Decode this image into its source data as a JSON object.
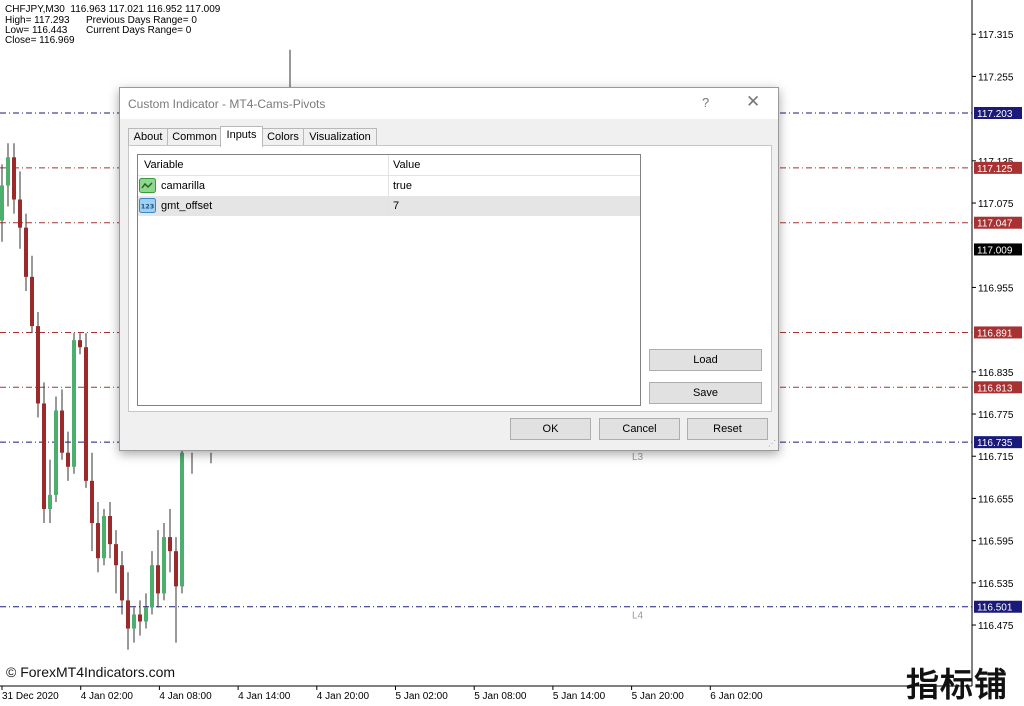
{
  "chart": {
    "symbol_line": "CHFJPY,M30  116.963 117.021 116.952 117.009",
    "info_left": [
      "High= 117.293",
      "Low= 116.443",
      "Close= 116.969"
    ],
    "info_right": [
      "Previous Days Range= 0",
      "Current Days Range= 0"
    ],
    "price_labels": [
      {
        "price": 117.315,
        "text": "117.315"
      },
      {
        "price": 117.255,
        "text": "117.255"
      },
      {
        "price": 117.135,
        "text": "117.135"
      },
      {
        "price": 117.075,
        "text": "117.075"
      },
      {
        "price": 116.955,
        "text": "116.955"
      },
      {
        "price": 116.835,
        "text": "116.835"
      },
      {
        "price": 116.775,
        "text": "116.775"
      },
      {
        "price": 116.715,
        "text": "116.715"
      },
      {
        "price": 116.655,
        "text": "116.655"
      },
      {
        "price": 116.595,
        "text": "116.595"
      },
      {
        "price": 116.535,
        "text": "116.535"
      },
      {
        "price": 116.475,
        "text": "116.475"
      }
    ],
    "pivot_lines": [
      {
        "price": 117.203,
        "text": "117.203",
        "color": "#1a1a7a"
      },
      {
        "price": 117.125,
        "text": "117.125",
        "color": "#a83232"
      },
      {
        "price": 117.047,
        "text": "117.047",
        "color": "#a83232"
      },
      {
        "price": 116.891,
        "text": "116.891",
        "color": "#a83232"
      },
      {
        "price": 116.813,
        "text": "116.813",
        "color": "#a83232"
      },
      {
        "price": 116.735,
        "text": "116.735",
        "color": "#1a1a7a"
      },
      {
        "price": 116.501,
        "text": "116.501",
        "color": "#1a1a7a"
      }
    ],
    "current_price": {
      "price": 117.009,
      "text": "117.009"
    },
    "level_labels": [
      {
        "price": 116.715,
        "text": "L3"
      },
      {
        "price": 116.49,
        "text": "L4"
      }
    ],
    "time_labels": [
      "31 Dec 2020",
      "4 Jan 02:00",
      "4 Jan 08:00",
      "4 Jan 14:00",
      "4 Jan 20:00",
      "5 Jan 02:00",
      "5 Jan 08:00",
      "5 Jan 14:00",
      "5 Jan 20:00",
      "6 Jan 02:00"
    ],
    "candles": [
      {
        "o": 117.05,
        "h": 117.13,
        "l": 117.02,
        "c": 117.1
      },
      {
        "o": 117.1,
        "h": 117.16,
        "l": 117.07,
        "c": 117.14
      },
      {
        "o": 117.14,
        "h": 117.16,
        "l": 117.06,
        "c": 117.08
      },
      {
        "o": 117.08,
        "h": 117.12,
        "l": 117.01,
        "c": 117.04
      },
      {
        "o": 117.04,
        "h": 117.06,
        "l": 116.95,
        "c": 116.97
      },
      {
        "o": 116.97,
        "h": 117.0,
        "l": 116.89,
        "c": 116.9
      },
      {
        "o": 116.9,
        "h": 116.92,
        "l": 116.77,
        "c": 116.79
      },
      {
        "o": 116.79,
        "h": 116.82,
        "l": 116.62,
        "c": 116.64
      },
      {
        "o": 116.64,
        "h": 116.71,
        "l": 116.62,
        "c": 116.66
      },
      {
        "o": 116.66,
        "h": 116.8,
        "l": 116.65,
        "c": 116.78
      },
      {
        "o": 116.78,
        "h": 116.81,
        "l": 116.71,
        "c": 116.72
      },
      {
        "o": 116.72,
        "h": 116.75,
        "l": 116.68,
        "c": 116.7
      },
      {
        "o": 116.7,
        "h": 116.89,
        "l": 116.69,
        "c": 116.88
      },
      {
        "o": 116.88,
        "h": 116.89,
        "l": 116.86,
        "c": 116.87
      },
      {
        "o": 116.87,
        "h": 116.89,
        "l": 116.67,
        "c": 116.68
      },
      {
        "o": 116.68,
        "h": 116.72,
        "l": 116.58,
        "c": 116.62
      },
      {
        "o": 116.62,
        "h": 116.65,
        "l": 116.55,
        "c": 116.57
      },
      {
        "o": 116.57,
        "h": 116.64,
        "l": 116.56,
        "c": 116.63
      },
      {
        "o": 116.63,
        "h": 116.65,
        "l": 116.57,
        "c": 116.59
      },
      {
        "o": 116.59,
        "h": 116.61,
        "l": 116.52,
        "c": 116.56
      },
      {
        "o": 116.56,
        "h": 116.58,
        "l": 116.49,
        "c": 116.51
      },
      {
        "o": 116.51,
        "h": 116.55,
        "l": 116.44,
        "c": 116.47
      },
      {
        "o": 116.47,
        "h": 116.5,
        "l": 116.45,
        "c": 116.49
      },
      {
        "o": 116.49,
        "h": 116.51,
        "l": 116.46,
        "c": 116.48
      },
      {
        "o": 116.48,
        "h": 116.52,
        "l": 116.47,
        "c": 116.5
      },
      {
        "o": 116.5,
        "h": 116.58,
        "l": 116.49,
        "c": 116.56
      },
      {
        "o": 116.56,
        "h": 116.61,
        "l": 116.5,
        "c": 116.52
      },
      {
        "o": 116.52,
        "h": 116.62,
        "l": 116.51,
        "c": 116.6
      },
      {
        "o": 116.6,
        "h": 116.64,
        "l": 116.55,
        "c": 116.58
      },
      {
        "o": 116.58,
        "h": 116.6,
        "l": 116.45,
        "c": 116.53
      },
      {
        "o": 116.53,
        "h": 116.74,
        "l": 116.52,
        "c": 116.72
      }
    ]
  },
  "watermark": "© ForexMT4Indicators.com",
  "brand": "指标铺",
  "dialog": {
    "title": "Custom Indicator - MT4-Cams-Pivots",
    "help_glyph": "?",
    "close_glyph": "✕",
    "tabs": [
      {
        "label": "About"
      },
      {
        "label": "Common"
      },
      {
        "label": "Inputs"
      },
      {
        "label": "Colors"
      },
      {
        "label": "Visualization"
      }
    ],
    "active_tab": "Inputs",
    "grid": {
      "headers": {
        "variable": "Variable",
        "value": "Value"
      },
      "rows": [
        {
          "icon": "boolean-toggle-icon",
          "variable": "camarilla",
          "value": "true"
        },
        {
          "icon": "numeric-123-icon",
          "icon_text": "123",
          "variable": "gmt_offset",
          "value": "7"
        }
      ]
    },
    "buttons": {
      "load": "Load",
      "save": "Save",
      "ok": "OK",
      "cancel": "Cancel",
      "reset": "Reset"
    },
    "accent": "#56a8e0"
  }
}
